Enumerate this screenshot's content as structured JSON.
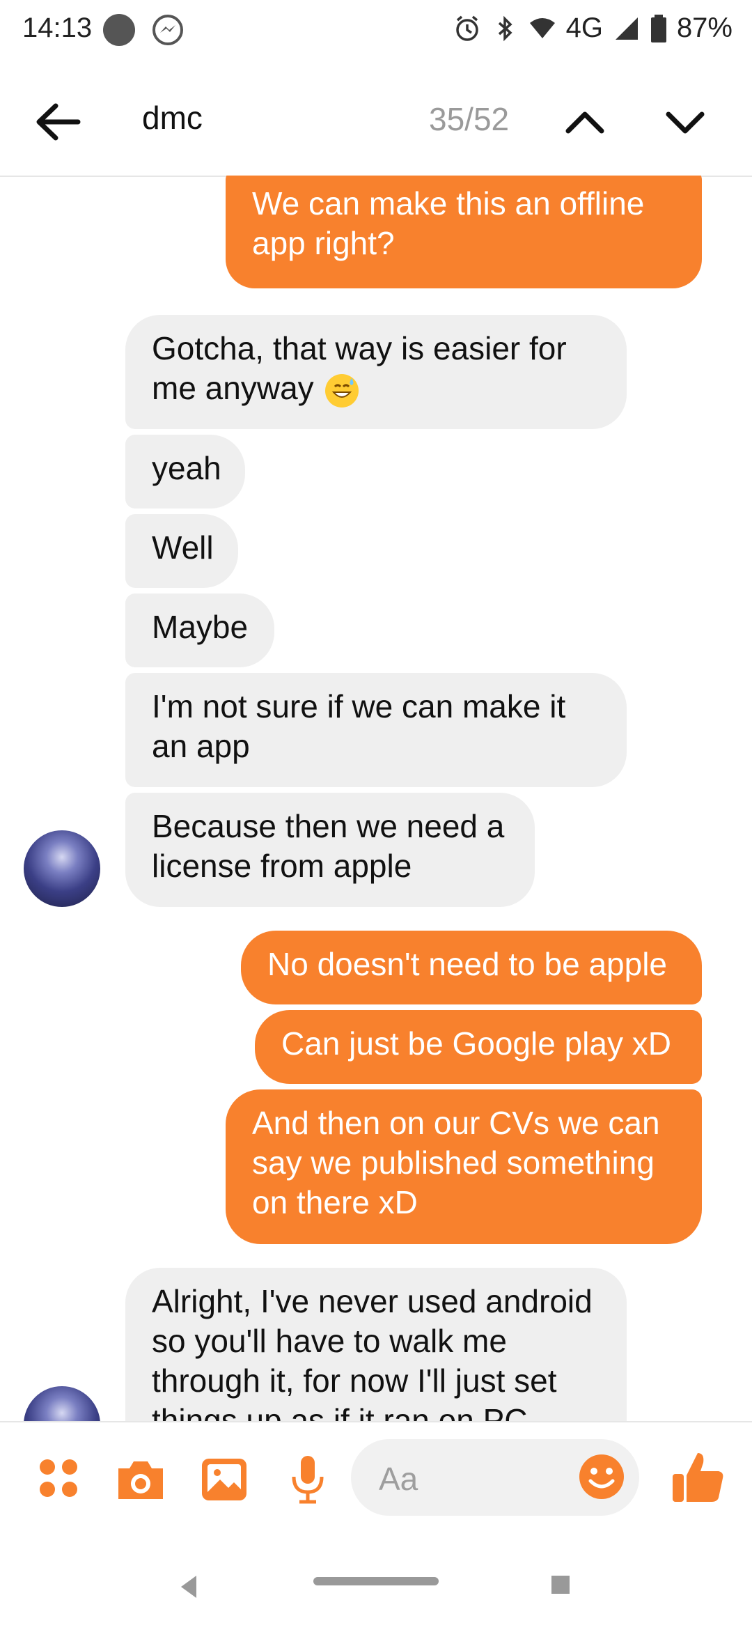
{
  "status_bar": {
    "time": "14:13",
    "network": "4G",
    "battery": "87%"
  },
  "search": {
    "query": "dmc",
    "match_counter": "35/52"
  },
  "messages": [
    {
      "side": "out",
      "text": "We can make this an offline app right?"
    },
    {
      "side": "in",
      "text": "Gotcha, that way is easier for me anyway",
      "emoji": "grinning-sweat-emoji"
    },
    {
      "side": "in",
      "text": "yeah"
    },
    {
      "side": "in",
      "text": "Well"
    },
    {
      "side": "in",
      "text": "Maybe"
    },
    {
      "side": "in",
      "text": "I'm not sure if we can make it an app"
    },
    {
      "side": "in",
      "text": "Because then we need a license from apple"
    },
    {
      "side": "out",
      "text": "No doesn't need to be apple"
    },
    {
      "side": "out",
      "text": "Can just be Google play xD"
    },
    {
      "side": "out",
      "text": "And then on our CVs we can say we published something on there xD"
    },
    {
      "side": "in",
      "text": "Alright, I've never used android so you'll have to walk me through it, for now I'll just set things up as if it ran on PC"
    }
  ],
  "composer": {
    "placeholder": "Aa"
  },
  "colors": {
    "accent": "#f8812d",
    "incoming_bubble": "#efefef"
  }
}
